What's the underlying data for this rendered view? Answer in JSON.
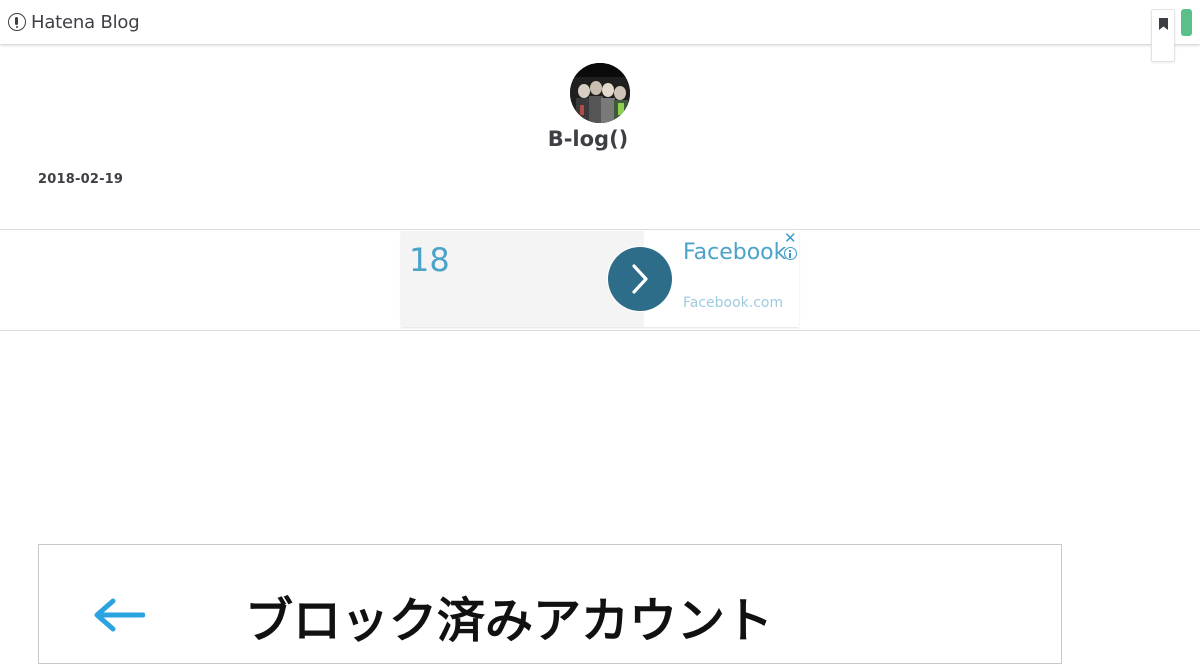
{
  "header": {
    "logo_text": "Hatena Blog",
    "bookmark_icon": "bookmark-icon",
    "accent_color": "#5bbf8a"
  },
  "blog": {
    "title": "B-log()",
    "avatar_icon": "avatar-image",
    "date": "2018-02-19"
  },
  "ad": {
    "number": "18",
    "headline": "Facebook",
    "domain": "Facebook.com",
    "close_symbol": "✕",
    "arrow_icon": "chevron-right-icon",
    "info_icon": "info-icon",
    "accent_color": "#4ba3c9",
    "button_color": "#2d6d8a"
  },
  "article_image": {
    "heading_text": "ブロック済みアカウント",
    "back_icon": "left-arrow-icon",
    "arrow_color": "#2aa3e0"
  }
}
